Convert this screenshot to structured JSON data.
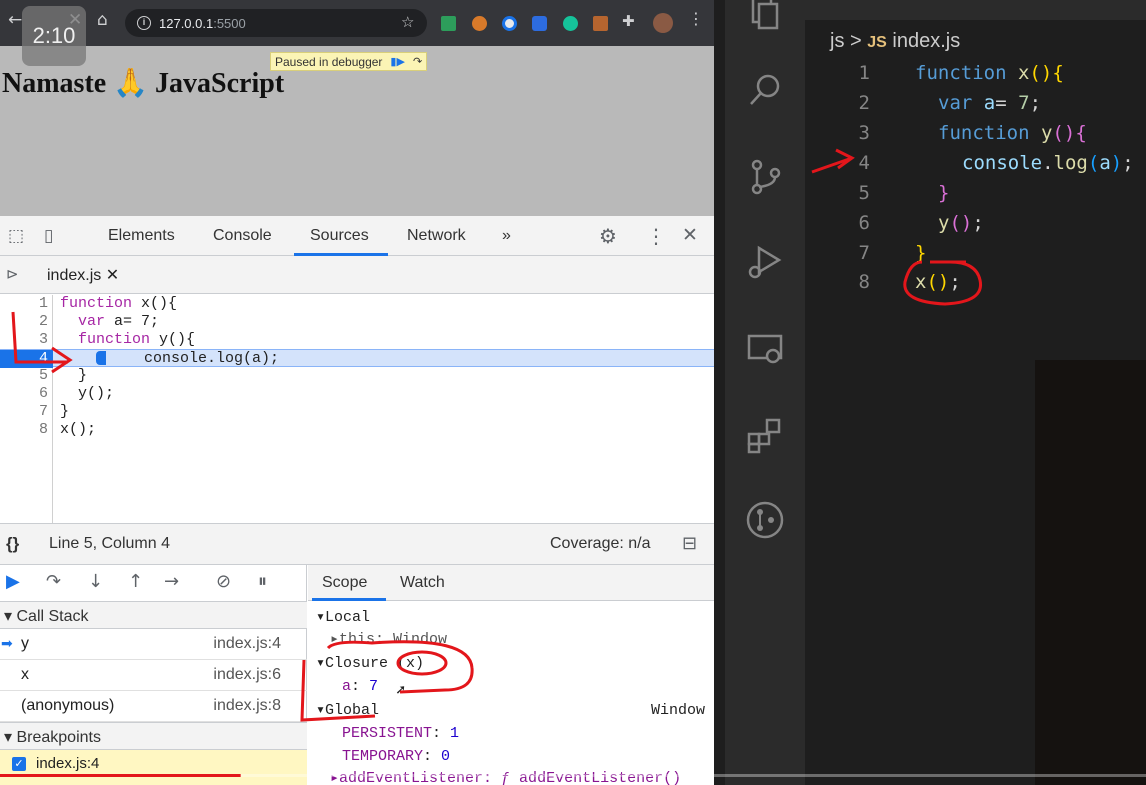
{
  "overlay": {
    "time_badge": "2:10"
  },
  "browser": {
    "url_host": "127.0.0.1",
    "url_port": ":5500",
    "page_heading": "Namaste 🙏 JavaScript",
    "paused_banner": "Paused in debugger"
  },
  "devtools": {
    "tabs": [
      "Elements",
      "Console",
      "Sources",
      "Network",
      "»"
    ],
    "active_tab": "Sources",
    "file_tab": "index.js",
    "code_lines": [
      "function x(){",
      "  var a= 7;",
      "  function y(){",
      "    console.log(a);",
      "  }",
      "  y();",
      "}",
      "x();"
    ],
    "execution_line": 4,
    "status": {
      "braces": "{}",
      "position": "Line 5, Column 4",
      "coverage": "Coverage: n/a"
    },
    "call_stack": {
      "header": "Call Stack",
      "frames": [
        {
          "name": "y",
          "location": "index.js:4"
        },
        {
          "name": "x",
          "location": "index.js:6"
        },
        {
          "name": "(anonymous)",
          "location": "index.js:8"
        }
      ]
    },
    "breakpoints": {
      "header": "Breakpoints",
      "items": [
        {
          "label": "index.js:4"
        }
      ]
    },
    "scope_tabs": [
      "Scope",
      "Watch"
    ],
    "scope": {
      "local": "Local",
      "this_line": "this: Window",
      "closure": "Closure (x)",
      "closure_var_name": "a",
      "closure_var_value": "7",
      "global": "Global",
      "global_value": "Window",
      "persistent_name": "PERSISTENT",
      "persistent_value": "1",
      "temporary_name": "TEMPORARY",
      "temporary_value": "0",
      "add_listener": "addEventListener: ƒ addEventListener()"
    }
  },
  "vscode": {
    "breadcrumb_folder": "js",
    "breadcrumb_sep": ">",
    "breadcrumb_badge": "JS",
    "breadcrumb_file": "index.js",
    "line_numbers": [
      "1",
      "2",
      "3",
      "4",
      "5",
      "6",
      "7",
      "8"
    ]
  },
  "colors": {
    "accent": "#1a73e8",
    "annotation_red": "#e3161b",
    "vscode_bg": "#1e1e1e",
    "chrome_toolbar": "#35363a"
  },
  "video_progress": 0.21
}
